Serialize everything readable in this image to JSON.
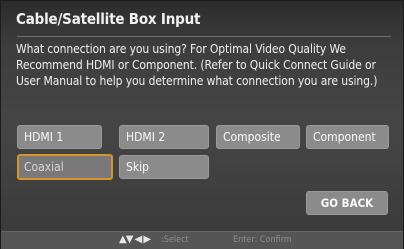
{
  "dialog": {
    "title": "Cable/Satellite Box Input",
    "description": "What connection are you using? For Optimal Video Quality We Recommend HDMI or Component. (Refer to Quick Connect Guide or User Manual to help you determine what connection you are using.)"
  },
  "options": [
    "HDMI 1",
    "HDMI 2",
    "Composite",
    "Component",
    "Coaxial",
    "Skip"
  ],
  "selected_option": "Coaxial",
  "go_back_label": "GO BACK",
  "footer": {
    "nav_glyphs": "▲▼ ◀ ▶",
    "select_hint": ":Select",
    "confirm_hint": "Enter: Confirm"
  },
  "colors": {
    "selection_border": "#d9932a",
    "button_fill": "#8b8b8b",
    "panel": "#454545"
  }
}
